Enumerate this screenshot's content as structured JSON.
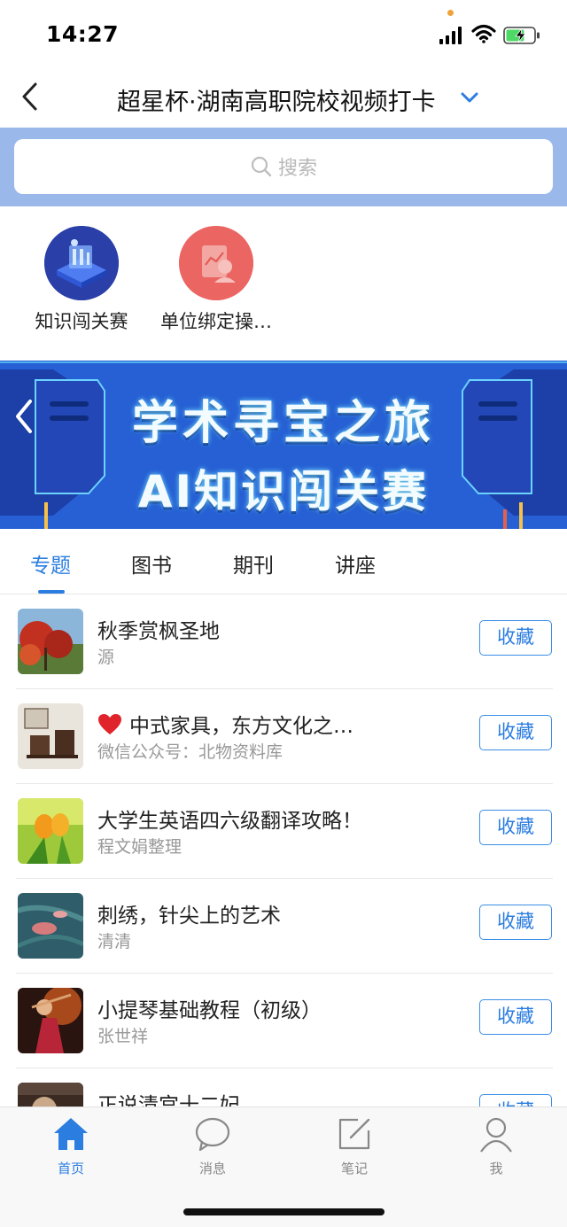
{
  "status": {
    "time": "14:27"
  },
  "nav": {
    "title": "超星杯·湖南高职院校视频打卡"
  },
  "search": {
    "placeholder": "搜索"
  },
  "quick_apps": [
    {
      "label": "知识闯关赛",
      "icon": "knowledge-contest-icon"
    },
    {
      "label": "单位绑定操…",
      "icon": "unit-binding-icon"
    }
  ],
  "banner": {
    "line1": "学术寻宝之旅",
    "line2": "AI知识闯关赛"
  },
  "tabs": [
    {
      "label": "专题",
      "active": true
    },
    {
      "label": "图书",
      "active": false
    },
    {
      "label": "期刊",
      "active": false
    },
    {
      "label": "讲座",
      "active": false
    }
  ],
  "list": [
    {
      "title": "秋季赏枫圣地",
      "subtitle": "源",
      "button": "收藏"
    },
    {
      "title": "中式家具，东方文化之…",
      "subtitle": "微信公众号：北物资料库",
      "button": "收藏",
      "icon": "heart-icon"
    },
    {
      "title": "大学生英语四六级翻译攻略！",
      "subtitle": "程文娟整理",
      "button": "收藏"
    },
    {
      "title": "刺绣，针尖上的艺术",
      "subtitle": "清清",
      "button": "收藏"
    },
    {
      "title": "小提琴基础教程（初级）",
      "subtitle": "张世祥",
      "button": "收藏"
    },
    {
      "title": "正说清宫十二妃",
      "subtitle": "",
      "button": "收藏"
    }
  ],
  "bottom_nav": [
    {
      "label": "首页",
      "icon": "home-icon",
      "active": true
    },
    {
      "label": "消息",
      "icon": "message-icon",
      "active": false
    },
    {
      "label": "笔记",
      "icon": "note-icon",
      "active": false
    },
    {
      "label": "我",
      "icon": "profile-icon",
      "active": false
    }
  ],
  "colors": {
    "accent": "#2b7de0",
    "search_bg": "#9ab8ea",
    "banner_bg": "#2761d6"
  }
}
